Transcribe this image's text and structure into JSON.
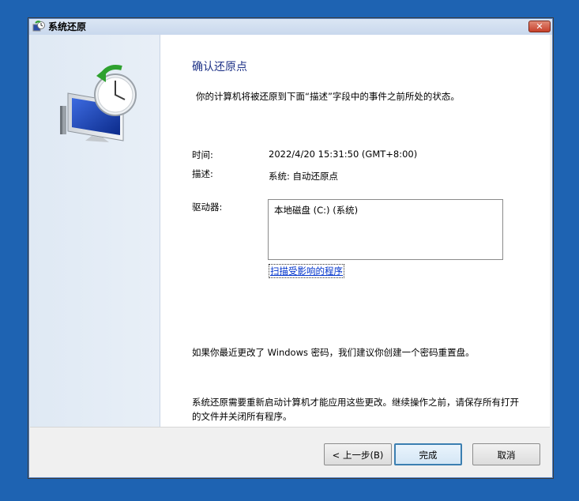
{
  "window": {
    "title": "系统还原"
  },
  "page": {
    "heading": "确认还原点",
    "description": "你的计算机将被还原到下面“描述”字段中的事件之前所处的状态。"
  },
  "details": {
    "time_label": "时间:",
    "time_value": "2022/4/20 15:31:50 (GMT+8:00)",
    "desc_label": "描述:",
    "desc_value": "系统: 自动还原点",
    "drives_label": "驱动器:",
    "drives": [
      "本地磁盘 (C:) (系统)"
    ],
    "scan_link": "扫描受影响的程序"
  },
  "notes": {
    "password": "如果你最近更改了 Windows 密码，我们建议你创建一个密码重置盘。",
    "restart": "系统还原需要重新启动计算机才能应用这些更改。继续操作之前，请保存所有打开的文件并关闭所有程序。"
  },
  "buttons": {
    "back": "< 上一步(B)",
    "finish": "完成",
    "cancel": "取消"
  },
  "icons": {
    "title": "system-restore-icon",
    "hero": "system-restore-clock-monitor-icon",
    "close": "close-icon"
  }
}
